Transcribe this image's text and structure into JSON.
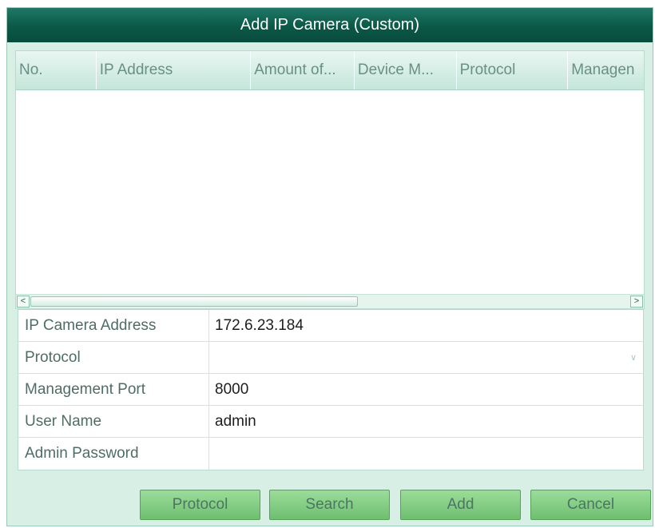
{
  "dialog": {
    "title": "Add IP Camera (Custom)"
  },
  "table": {
    "columns": [
      "No.",
      "IP Address",
      "Amount of...",
      "Device M...",
      "Protocol",
      "Managen"
    ],
    "rows": [],
    "scrollbar": {
      "left_arrow": "<",
      "right_arrow": ">"
    }
  },
  "form": {
    "ip_camera_address": {
      "label": "IP Camera Address",
      "value": "172.6.23.184"
    },
    "protocol": {
      "label": "Protocol",
      "value": ""
    },
    "management_port": {
      "label": "Management Port",
      "value": "8000"
    },
    "user_name": {
      "label": "User Name",
      "value": "admin"
    },
    "admin_password": {
      "label": "Admin Password",
      "value": ""
    }
  },
  "buttons": {
    "protocol": "Protocol",
    "search": "Search",
    "add": "Add",
    "cancel": "Cancel"
  },
  "colors": {
    "title_bar": "#0b5847",
    "dialog_background": "#d8efe6",
    "button_green": "#7fca7f"
  }
}
